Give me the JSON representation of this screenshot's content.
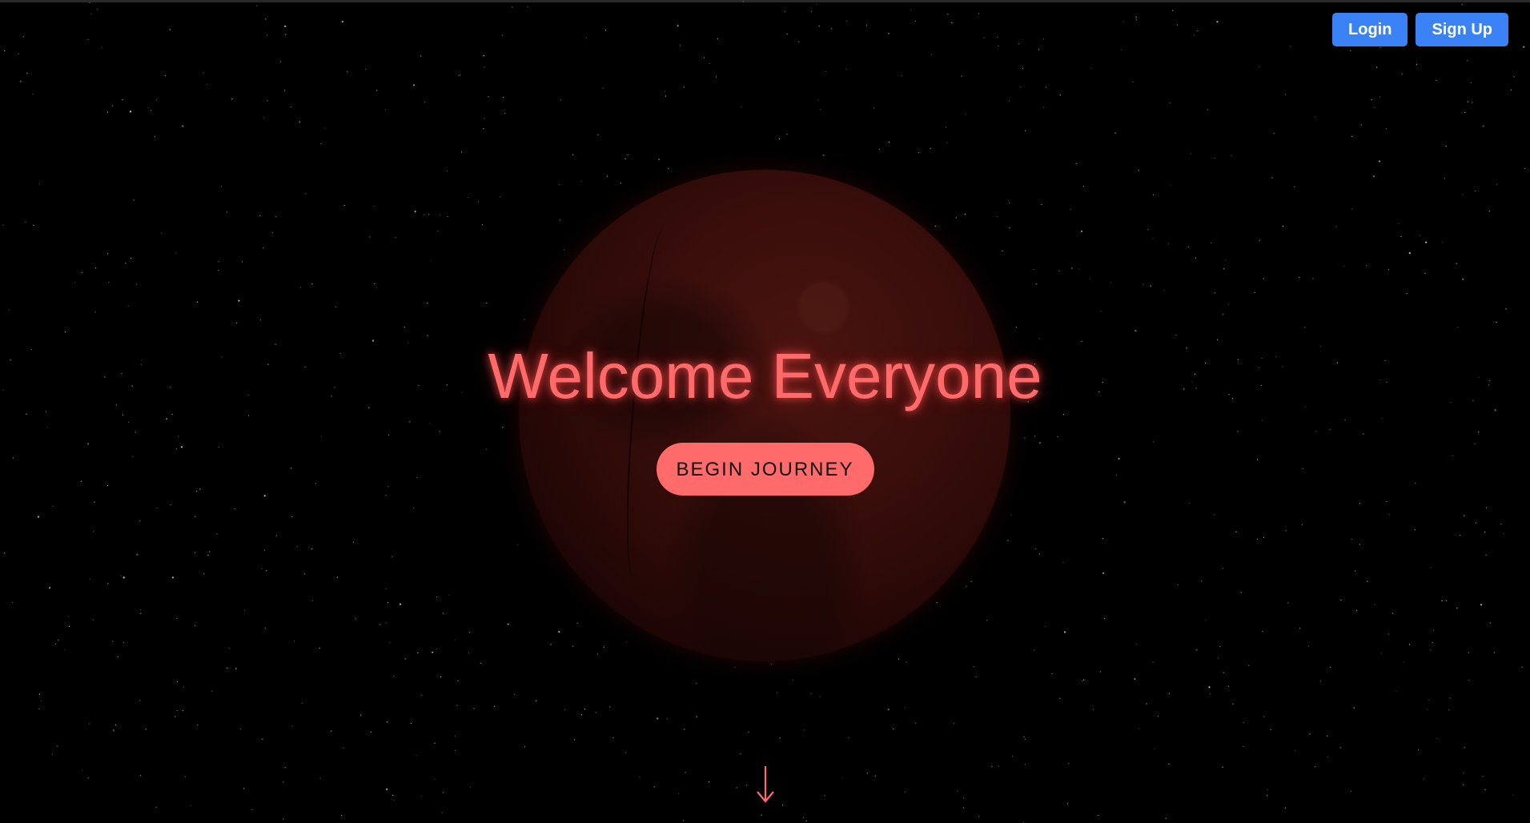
{
  "auth": {
    "login_label": "Login",
    "signup_label": "Sign Up"
  },
  "hero": {
    "title": "Welcome Everyone",
    "cta_label": "BEGIN JOURNEY"
  },
  "icons": {
    "scroll_indicator": "arrow-down-icon"
  },
  "colors": {
    "background": "#000000",
    "accent": "#ff6b6b",
    "auth_button": "#3b82f6",
    "planet": "#3a0e0b"
  }
}
